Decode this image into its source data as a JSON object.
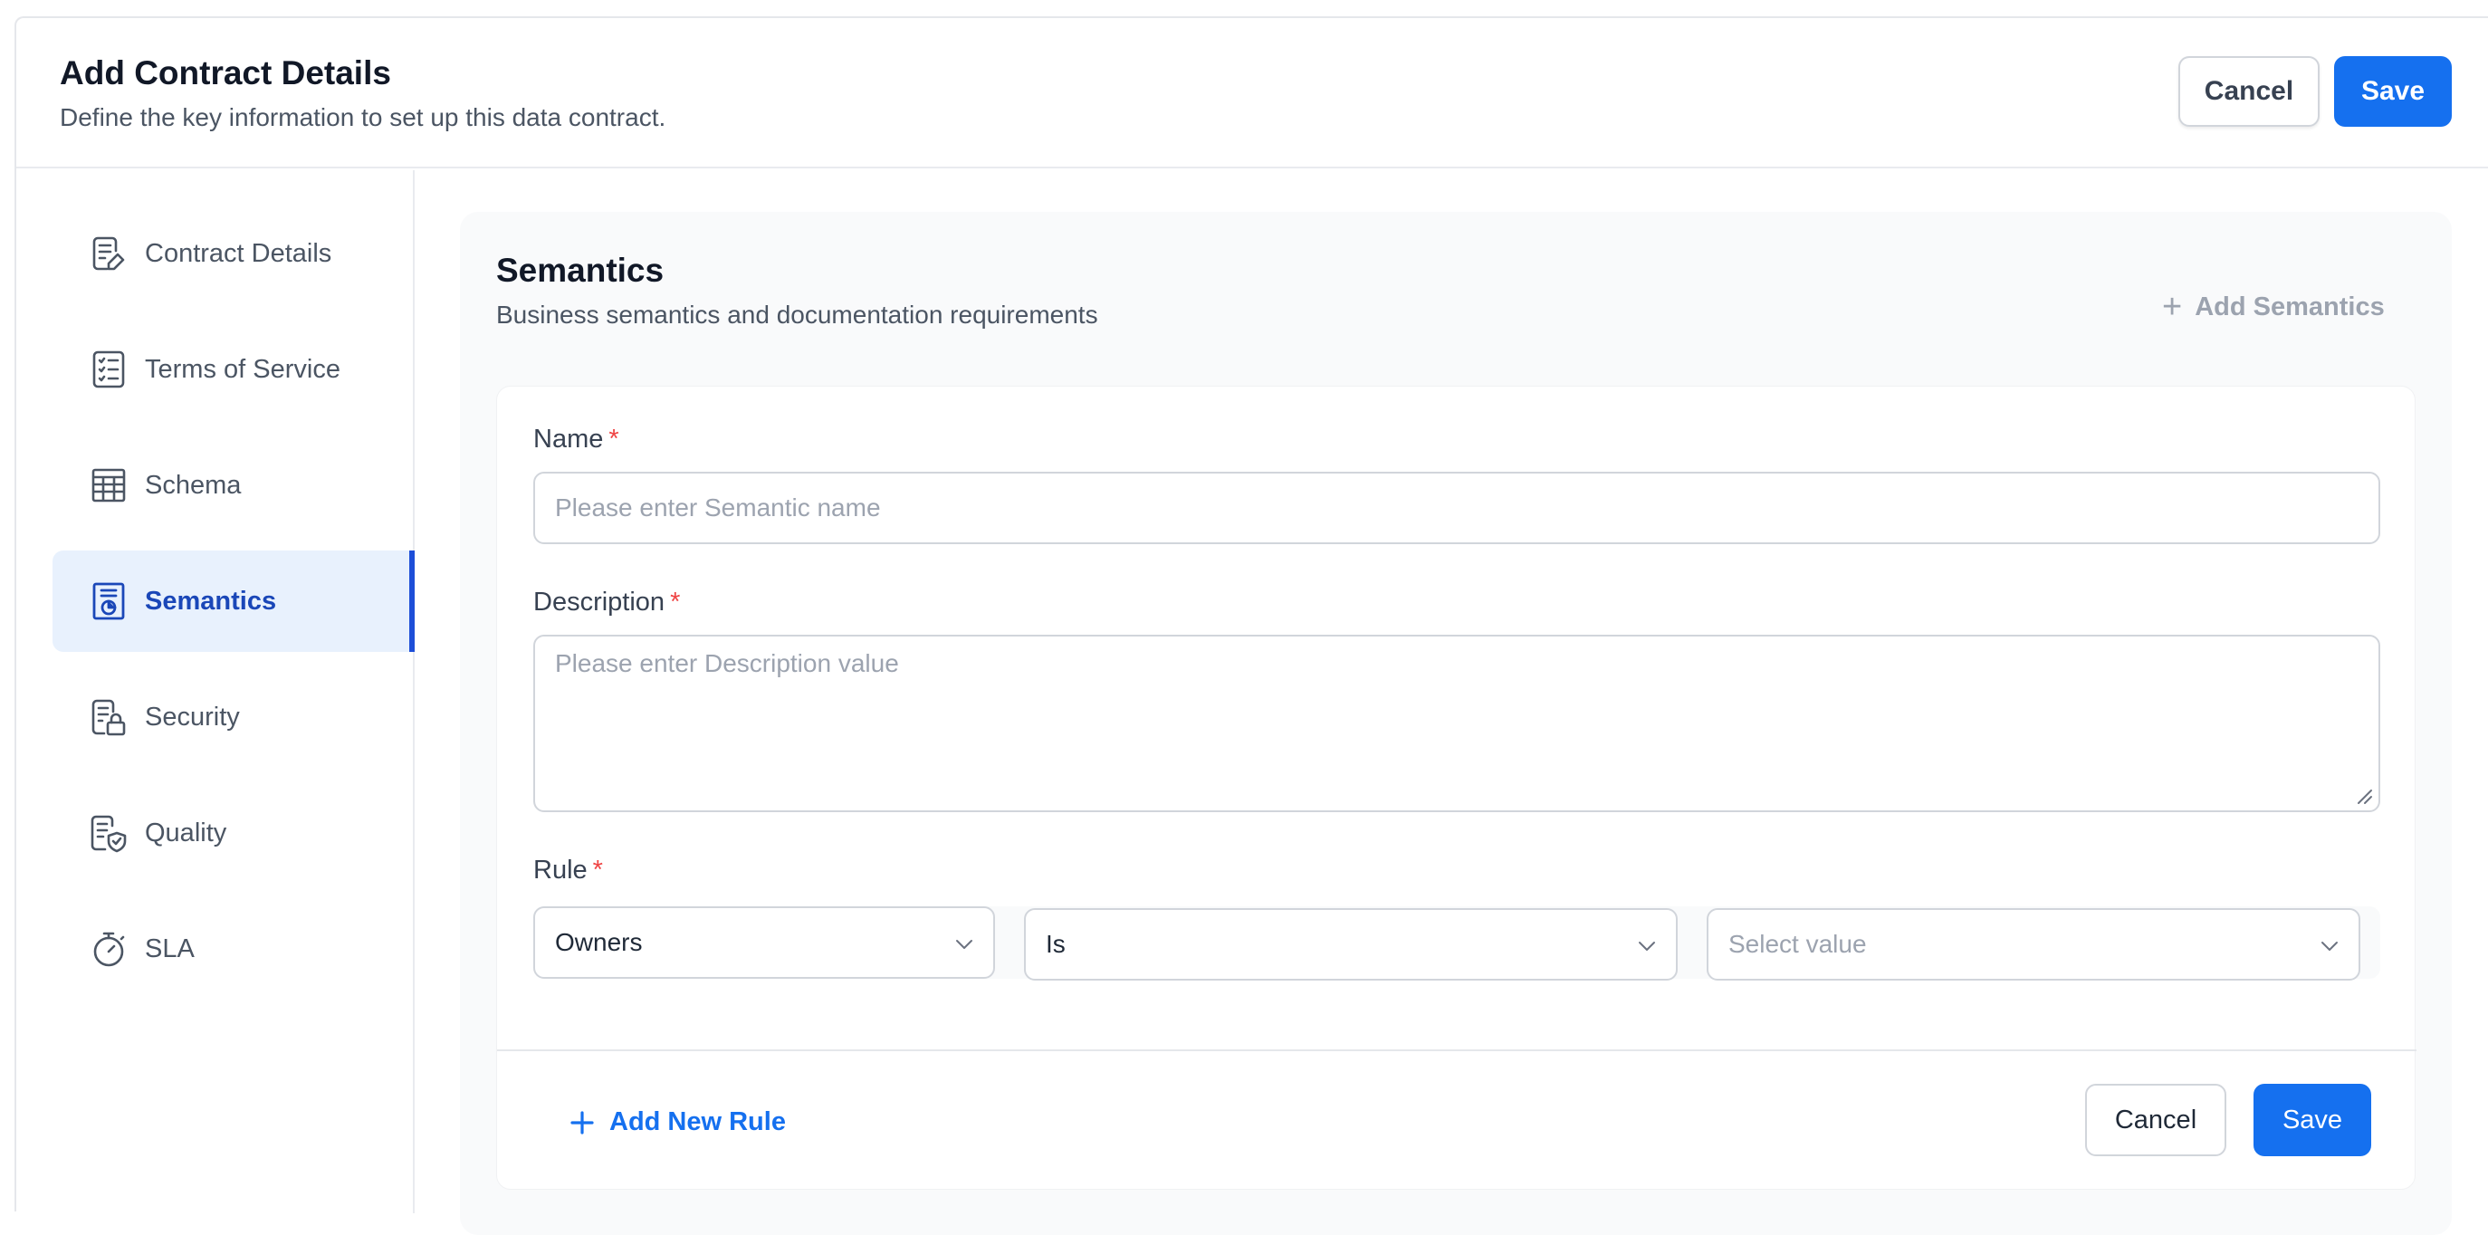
{
  "header": {
    "title": "Add Contract Details",
    "subtitle": "Define the key information to set up this data contract.",
    "cancel_label": "Cancel",
    "save_label": "Save"
  },
  "sidebar": {
    "items": [
      {
        "label": "Contract Details",
        "icon": "contract-details-icon"
      },
      {
        "label": "Terms of Service",
        "icon": "terms-of-service-icon"
      },
      {
        "label": "Schema",
        "icon": "table-grid-icon"
      },
      {
        "label": "Semantics",
        "icon": "semantics-icon",
        "active": true
      },
      {
        "label": "Security",
        "icon": "document-lock-icon"
      },
      {
        "label": "Quality",
        "icon": "document-shield-icon"
      },
      {
        "label": "SLA",
        "icon": "stopwatch-icon"
      }
    ]
  },
  "panel": {
    "title": "Semantics",
    "subtitle": "Business semantics and documentation requirements",
    "add_label": "Add Semantics"
  },
  "form": {
    "name_label": "Name",
    "name_placeholder": "Please enter Semantic name",
    "description_label": "Description",
    "description_placeholder": "Please enter Description value",
    "rule_label": "Rule",
    "required_mark": "*",
    "rule": {
      "field": "Owners",
      "operator": "Is",
      "value_placeholder": "Select value"
    },
    "add_rule_label": "Add New Rule",
    "cancel_label": "Cancel",
    "save_label": "Save"
  },
  "colors": {
    "primary": "#1570ef",
    "active_bg": "#e8f1fd",
    "active_text": "#1a47b8",
    "required": "#ef4444"
  }
}
